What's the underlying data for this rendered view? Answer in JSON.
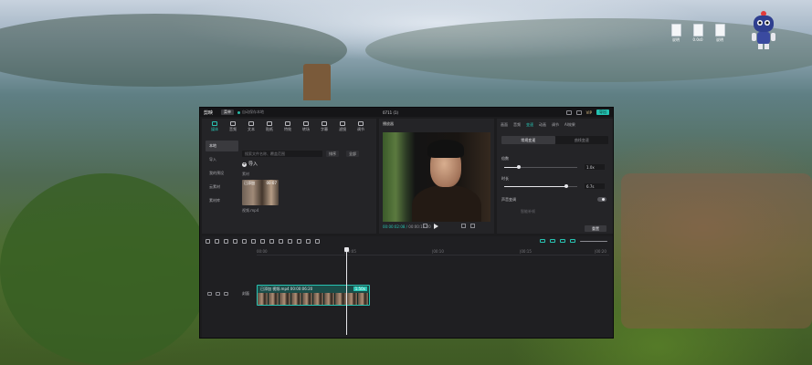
{
  "desktop": {
    "icons": [
      {
        "label": "说明",
        "name": "document-icon"
      },
      {
        "label": "0.0s0",
        "name": "document-icon"
      },
      {
        "label": "说明",
        "name": "document-icon"
      }
    ],
    "mascot_label": "机器人助手"
  },
  "app": {
    "logo": "剪映",
    "menu_label": "菜单",
    "autosave": "自动保存本地",
    "project_title": "0711 (1)",
    "vip_label": "VIP",
    "export_label": "导出"
  },
  "media": {
    "tools": [
      {
        "label": "媒体",
        "icon": "media-icon",
        "active": true
      },
      {
        "label": "音频",
        "icon": "audio-icon",
        "active": false
      },
      {
        "label": "文本",
        "icon": "text-icon",
        "active": false
      },
      {
        "label": "贴纸",
        "icon": "sticker-icon",
        "active": false
      },
      {
        "label": "特效",
        "icon": "effects-icon",
        "active": false
      },
      {
        "label": "转场",
        "icon": "transition-icon",
        "active": false
      },
      {
        "label": "字幕",
        "icon": "caption-icon",
        "active": false
      },
      {
        "label": "滤镜",
        "icon": "filter-icon",
        "active": false
      },
      {
        "label": "调节",
        "icon": "adjust-icon",
        "active": false
      }
    ],
    "sidebar": [
      {
        "label": "本地",
        "active": true
      },
      {
        "label": "导入",
        "active": false
      },
      {
        "label": "我的预设",
        "active": false
      },
      {
        "label": "云素材",
        "active": false
      },
      {
        "label": "素材库",
        "active": false
      }
    ],
    "search_placeholder": "搜索文件名称、覆盖范围",
    "sort_label": "排序",
    "view_label": "全部",
    "import_label": "导入",
    "section_label": "素材",
    "clip": {
      "badge": "已添加",
      "duration": "00:07",
      "name": "视频.mp4"
    }
  },
  "player": {
    "title": "播放器",
    "timecode_current": "00:00:02:08",
    "timecode_total": "00:00:15:20"
  },
  "properties": {
    "tabs": [
      "画面",
      "音频",
      "变速",
      "动画",
      "调节",
      "AI效果"
    ],
    "active_tab": "变速",
    "segments": [
      "常规变速",
      "曲线变速"
    ],
    "rows": [
      {
        "label": "倍数",
        "value": "1.0x",
        "fill": 0.2
      },
      {
        "label": "时长",
        "value": "6.7s",
        "fill": 0.85
      }
    ],
    "toggle_label": "声音变调",
    "toggle_note": "智能补帧",
    "bottom_button": "重置"
  },
  "timeline": {
    "ruler": [
      "00:00",
      "|00:05",
      "|00:10",
      "|00:15",
      "|00:20"
    ],
    "cover_label": "封面",
    "clip_label": "已添加  视频.mp4  00:00:06:20",
    "speed_badge": "1.50x"
  }
}
